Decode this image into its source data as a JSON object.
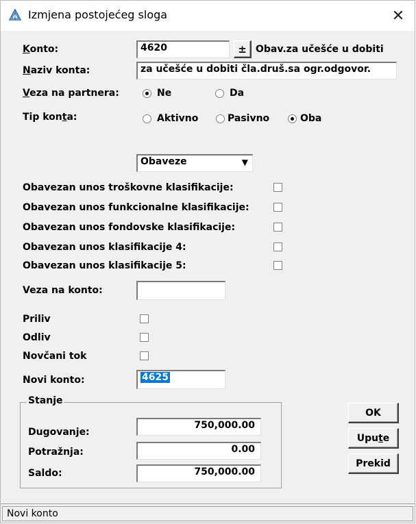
{
  "window": {
    "title": "Izmjena postojećeg sloga"
  },
  "form": {
    "konto": {
      "label_pre": "",
      "label_u": "K",
      "label_post": "onto:",
      "value": "4620",
      "lookup_btn": "±",
      "description": "Obav.za učešće u dobiti"
    },
    "naziv_konta": {
      "label_pre": "",
      "label_u": "N",
      "label_post": "aziv konta:",
      "value": "za učešće u dobiti čla.druš.sa ogr.odgovor."
    },
    "veza_na_partnera": {
      "label_pre": "",
      "label_u": "V",
      "label_post": "eza na partnera:",
      "options": [
        "Ne",
        "Da"
      ],
      "selected": "Ne"
    },
    "tip_konta": {
      "label_pre": "Tip kon",
      "label_u": "t",
      "label_post": "a:",
      "options": [
        "Aktivno",
        "Pasivno",
        "Oba"
      ],
      "selected": "Oba"
    },
    "dropdown": {
      "value": "Obaveze"
    },
    "klasifikacije": [
      {
        "label": "Obavezan unos troškovne klasifikacije:",
        "checked": false
      },
      {
        "label": "Obavezan unos funkcionalne klasifikacije:",
        "checked": false
      },
      {
        "label": "Obavezan unos fondovske klasifikacije:",
        "checked": false
      },
      {
        "label": "Obavezan unos klasifikacije 4:",
        "checked": false
      },
      {
        "label": "Obavezan unos klasifikacije 5:",
        "checked": false
      }
    ],
    "veza_na_konto": {
      "label": "Veza na konto:",
      "value": ""
    },
    "priliv": {
      "label": "Priliv",
      "checked": false
    },
    "odliv": {
      "label": "Odliv",
      "checked": false
    },
    "novcani_tok": {
      "label": "Novčani tok",
      "checked": false
    },
    "novi_konto": {
      "label": "Novi konto:",
      "value": "4625"
    }
  },
  "stanje": {
    "title": "Stanje",
    "dugovanje": {
      "label": "Dugovanje:",
      "value": "750,000.00"
    },
    "potraznja": {
      "label": "Potražnja:",
      "value": "0.00"
    },
    "saldo": {
      "label": "Saldo:",
      "value": "750,000.00"
    }
  },
  "buttons": {
    "ok": "OK",
    "upute_pre": "Upu",
    "upute_u": "t",
    "upute_post": "e",
    "prekid": "Prekid"
  },
  "statusbar": {
    "text": "Novi konto"
  }
}
